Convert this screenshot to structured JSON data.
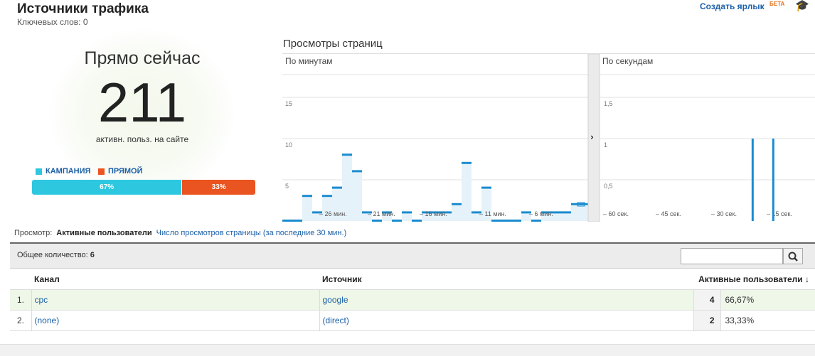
{
  "header": {
    "title": "Источники трафика",
    "keywords": "Ключевых слов: 0",
    "shortcut_label": "Создать ярлык",
    "beta_label": "БЕТА"
  },
  "right_now": {
    "label": "Прямо сейчас",
    "count": "211",
    "subtitle": "активн. польз. на сайте"
  },
  "ratio": {
    "campaign_label": "КАМПАНИЯ",
    "direct_label": "ПРЯМОЙ",
    "campaign_pct": "67%",
    "direct_pct": "33%",
    "campaign_value": 0.67,
    "colors": {
      "campaign": "#2ec7e0",
      "direct": "#ea5420"
    }
  },
  "pageviews": {
    "title": "Просмотры страниц",
    "per_minute_label": "По минутам",
    "per_second_label": "По секундам"
  },
  "chart_data": [
    {
      "type": "bar",
      "title": "По минутам",
      "ylim": [
        0,
        15
      ],
      "y_ticks": [
        "5",
        "10",
        "15"
      ],
      "x_tick_labels": [
        "– 26 мин.",
        "– 21 мин.",
        "– 16 мин.",
        "– 11 мин.",
        "– 6 мин."
      ],
      "categories": [
        "-30",
        "-29",
        "-28",
        "-27",
        "-26",
        "-25",
        "-24",
        "-23",
        "-22",
        "-21",
        "-20",
        "-19",
        "-18",
        "-17",
        "-16",
        "-15",
        "-14",
        "-13",
        "-12",
        "-11",
        "-10",
        "-9",
        "-8",
        "-7",
        "-6",
        "-5",
        "-4",
        "-3",
        "-2",
        "-1",
        "0"
      ],
      "values": [
        0,
        0,
        3,
        1,
        3,
        4,
        8,
        6,
        1,
        0,
        1,
        0,
        1,
        0,
        1,
        1,
        1,
        2,
        7,
        1,
        4,
        0,
        0,
        0,
        1,
        0,
        1,
        1,
        1,
        2,
        2
      ]
    },
    {
      "type": "bar",
      "title": "По секундам",
      "ylim": [
        0,
        1.5
      ],
      "y_ticks": [
        "0,5",
        "1",
        "1,5"
      ],
      "x_tick_labels": [
        "– 60 сек.",
        "– 45 сек.",
        "– 30 сек.",
        "– 15 сек."
      ],
      "x": [
        -17,
        -11
      ],
      "values": [
        1,
        1
      ]
    }
  ],
  "view_switch": {
    "label": "Просмотр:",
    "active": "Активные пользователи",
    "other": "Число просмотров страницы (за последние 30 мин.)"
  },
  "table": {
    "total_label": "Общее количество:",
    "total_value": "6",
    "search_placeholder": "",
    "columns": {
      "channel": "Канал",
      "source": "Источник",
      "active_users": "Активные пользователи"
    },
    "rows": [
      {
        "num": "1.",
        "channel": "cpc",
        "source": "google",
        "count": "4",
        "pct": "66,67%"
      },
      {
        "num": "2.",
        "channel": "(none)",
        "source": "(direct)",
        "count": "2",
        "pct": "33,33%"
      }
    ]
  }
}
